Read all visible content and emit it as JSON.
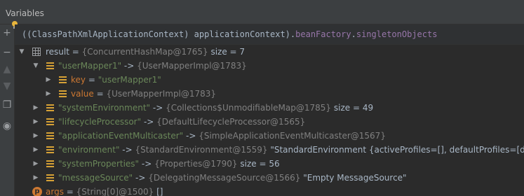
{
  "panel": {
    "title": "Variables"
  },
  "expression": {
    "prefix": "((ClassPathXmlApplicationContext) applicationContext).",
    "field1": "beanFactory",
    "dot": ".",
    "field2": "singletonObjects"
  },
  "gutter": {
    "icons": [
      "add-icon",
      "minus-icon",
      "up-icon",
      "down-icon",
      "copy-icon",
      "watch-icon"
    ]
  },
  "rows": [
    {
      "name": "result",
      "name_style": "plain",
      "eq": " = ",
      "type": "{ConcurrentHashMap@1765}",
      "value": "  size = 7"
    },
    {
      "name": "\"userMapper1\"",
      "name_style": "str",
      "eq": " -> ",
      "type": "{UserMapperImpl@1783}",
      "value": ""
    },
    {
      "name": "key",
      "name_style": "field",
      "eq": " = ",
      "type": "",
      "value": "\"userMapper1\""
    },
    {
      "name": "value",
      "name_style": "field",
      "eq": " = ",
      "type": "{UserMapperImpl@1783}",
      "value": ""
    },
    {
      "name": "\"systemEnvironment\"",
      "name_style": "str",
      "eq": " -> ",
      "type": "{Collections$UnmodifiableMap@1785}",
      "value": "  size = 49"
    },
    {
      "name": "\"lifecycleProcessor\"",
      "name_style": "str",
      "eq": " -> ",
      "type": "{DefaultLifecycleProcessor@1565}",
      "value": ""
    },
    {
      "name": "\"applicationEventMulticaster\"",
      "name_style": "str",
      "eq": " -> ",
      "type": "{SimpleApplicationEventMulticaster@1567}",
      "value": ""
    },
    {
      "name": "\"environment\"",
      "name_style": "str",
      "eq": " -> ",
      "type": "{StandardEnvironment@1559}",
      "value": " \"StandardEnvironment {activeProfiles=[], defaultProfiles=[default],\""
    },
    {
      "name": "\"systemProperties\"",
      "name_style": "str",
      "eq": " -> ",
      "type": "{Properties@1790}",
      "value": "  size = 56"
    },
    {
      "name": "\"messageSource\"",
      "name_style": "str",
      "eq": " -> ",
      "type": "{DelegatingMessageSource@1566}",
      "value": " \"Empty MessageSource\""
    },
    {
      "name": "args",
      "name_style": "field",
      "eq": " = ",
      "type": "{String[0]@1500}",
      "value": " []"
    }
  ],
  "icons": {
    "result": "table-icon",
    "entry": "map-entry-icon",
    "field": "field-icon",
    "param": "parameter-icon"
  },
  "colors": {
    "background": "#2b2b2b",
    "string": "#6a8759",
    "field": "#cc7832",
    "type": "#808080"
  }
}
